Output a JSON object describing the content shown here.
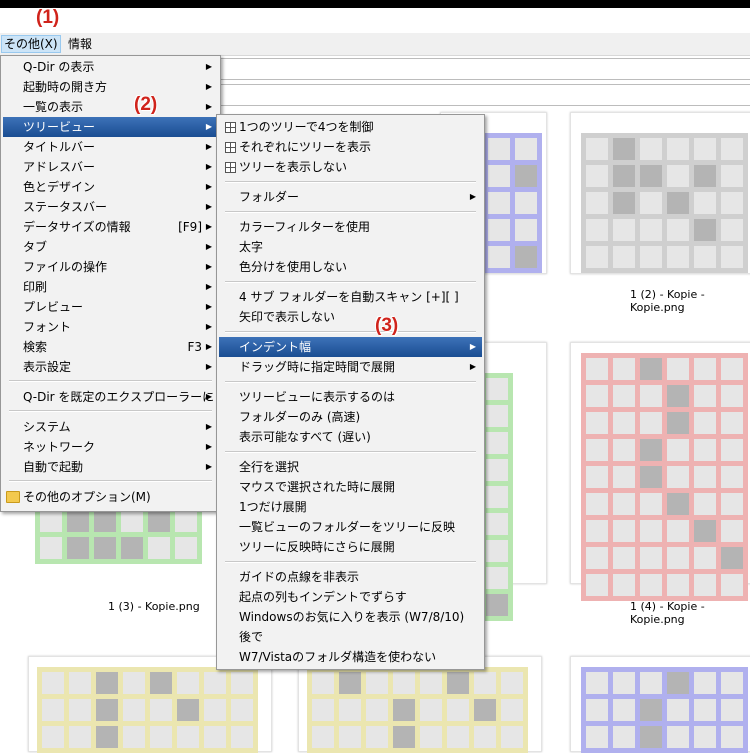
{
  "menubar": {
    "other": "その他(X)",
    "info": "情報"
  },
  "callouts": [
    "(1)",
    "(2)",
    "(3)"
  ],
  "main_menu": [
    {
      "label": "Q-Dir の表示",
      "arrow": true
    },
    {
      "label": "起動時の開き方",
      "arrow": true
    },
    {
      "label": "一覧の表示",
      "arrow": true
    },
    {
      "label": "ツリービュー",
      "arrow": true,
      "highlight": true
    },
    {
      "label": "タイトルバー",
      "arrow": true
    },
    {
      "label": "アドレスバー",
      "arrow": true
    },
    {
      "label": "色とデザイン",
      "arrow": true
    },
    {
      "label": "ステータスバー",
      "arrow": true
    },
    {
      "label": "データサイズの情報",
      "shortcut": "[F9]",
      "arrow": true
    },
    {
      "label": "タブ",
      "arrow": true
    },
    {
      "label": "ファイルの操作",
      "arrow": true
    },
    {
      "label": "印刷",
      "arrow": true
    },
    {
      "label": "プレビュー",
      "arrow": true
    },
    {
      "label": "フォント",
      "arrow": true
    },
    {
      "label": "検索",
      "shortcut": "F3",
      "arrow": true
    },
    {
      "label": "表示設定",
      "arrow": true
    },
    {
      "label": "Q-Dir を既定のエクスプローラーに",
      "arrow": true
    },
    {
      "label": "システム",
      "arrow": true
    },
    {
      "label": "ネットワーク",
      "arrow": true
    },
    {
      "label": "自動で起動",
      "arrow": true
    },
    {
      "label": "その他のオプション(M)",
      "icon": "folder-icon"
    }
  ],
  "tree_menu": [
    {
      "label": "1つのツリーで4つを制御",
      "icon": "tree-grid-icon"
    },
    {
      "label": "それぞれにツリーを表示",
      "icon": "tree-grid-icon"
    },
    {
      "label": "ツリーを表示しない",
      "icon": "tree-grid-icon"
    },
    {
      "label": "フォルダー",
      "arrow": true
    },
    {
      "label": "カラーフィルターを使用"
    },
    {
      "label": "太字"
    },
    {
      "label": "色分けを使用しない"
    },
    {
      "label": "4 サブ フォルダーを自動スキャン [+][ ]"
    },
    {
      "label": "矢印で表示しない"
    },
    {
      "label": "インデント幅",
      "arrow": true,
      "highlight": true
    },
    {
      "label": "ドラッグ時に指定時間で展開",
      "arrow": true
    },
    {
      "label": "ツリービューに表示するのは"
    },
    {
      "label": "フォルダーのみ (高速)"
    },
    {
      "label": "表示可能なすべて (遅い)"
    },
    {
      "label": "全行を選択"
    },
    {
      "label": "マウスで選択された時に展開"
    },
    {
      "label": "1つだけ展開"
    },
    {
      "label": "一覧ビューのフォルダーをツリーに反映"
    },
    {
      "label": "ツリーに反映時にさらに展開"
    },
    {
      "label": "ガイドの点線を非表示"
    },
    {
      "label": "起点の列もインデントでずらす"
    },
    {
      "label": "Windowsのお気に入りを表示 (W7/8/10)"
    },
    {
      "label": "後で"
    },
    {
      "label": "W7/Vistaのフォルダ構造を使わない"
    }
  ],
  "captions": [
    "1 (2) - Kopie - Kopie.png",
    "1 (3) - Kopie.png",
    "1 (4) - Kopie - Kopie.png"
  ],
  "colors": {
    "highlight": "#1a4d92",
    "callout": "#d0231b",
    "green": "#b8e6b0",
    "red": "#eeb2b2",
    "blue": "#b0b0ee",
    "yellow": "#ebe6b0",
    "gray": "#cfcfcf"
  }
}
